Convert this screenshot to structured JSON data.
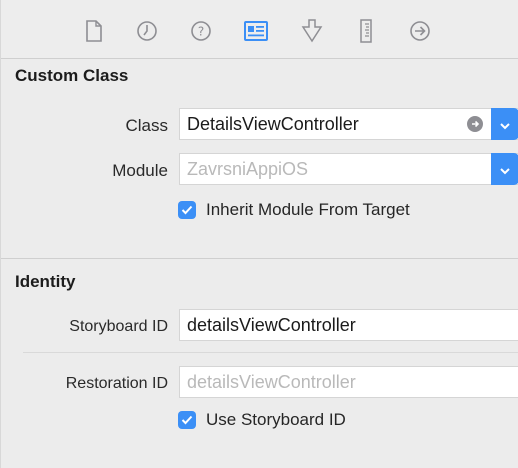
{
  "tabs": [
    {
      "name": "file-inspector",
      "icon": "file-icon",
      "selected": false
    },
    {
      "name": "history-inspector",
      "icon": "clock-icon",
      "selected": false
    },
    {
      "name": "quick-help-inspector",
      "icon": "help-icon",
      "selected": false
    },
    {
      "name": "identity-inspector",
      "icon": "identity-card-icon",
      "selected": true
    },
    {
      "name": "attributes-inspector",
      "icon": "attributes-icon",
      "selected": false
    },
    {
      "name": "size-inspector",
      "icon": "ruler-icon",
      "selected": false
    },
    {
      "name": "connections-inspector",
      "icon": "arrow-circle-icon",
      "selected": false
    }
  ],
  "custom_class": {
    "title": "Custom Class",
    "class_label": "Class",
    "class_value": "DetailsViewController",
    "module_label": "Module",
    "module_placeholder": "ZavrsniAppiOS",
    "inherit_label": "Inherit Module From Target",
    "inherit_checked": true
  },
  "identity": {
    "title": "Identity",
    "storyboard_id_label": "Storyboard ID",
    "storyboard_id_value": "detailsViewController",
    "restoration_id_label": "Restoration ID",
    "restoration_id_placeholder": "detailsViewController",
    "use_storyboard_label": "Use Storyboard ID",
    "use_storyboard_checked": true
  },
  "colors": {
    "accent": "#3b8ff6",
    "background": "#ececec",
    "icon_gray": "#8e8e93"
  }
}
